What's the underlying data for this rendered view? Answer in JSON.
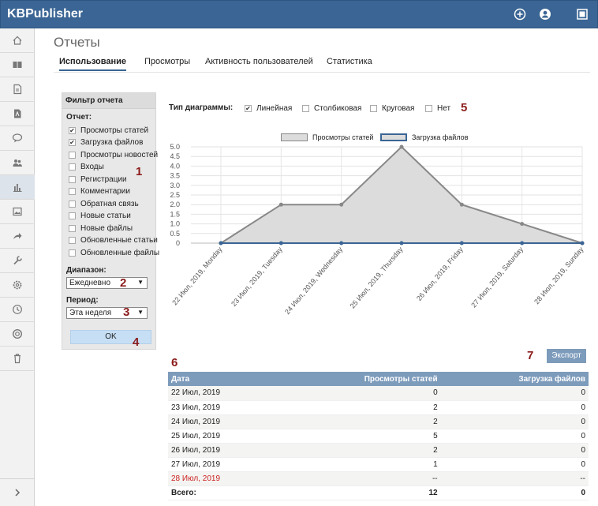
{
  "app": {
    "title": "KBPublisher"
  },
  "page": {
    "title": "Отчеты"
  },
  "tabs": [
    "Использование",
    "Просмотры",
    "Активность пользователей",
    "Статистика"
  ],
  "filter": {
    "title": "Фильтр отчета",
    "report_label": "Отчет:",
    "report_items": [
      {
        "label": "Просмотры статей",
        "checked": true
      },
      {
        "label": "Загрузка файлов",
        "checked": true
      },
      {
        "label": "Просмотры новостей",
        "checked": false
      },
      {
        "label": "Входы",
        "checked": false
      },
      {
        "label": "Регистрации",
        "checked": false
      },
      {
        "label": "Комментарии",
        "checked": false
      },
      {
        "label": "Обратная связь",
        "checked": false
      },
      {
        "label": "Новые статьи",
        "checked": false
      },
      {
        "label": "Новые файлы",
        "checked": false
      },
      {
        "label": "Обновленные статьи",
        "checked": false
      },
      {
        "label": "Обновленные файлы",
        "checked": false
      }
    ],
    "range_label": "Диапазон:",
    "range_value": "Ежедневно",
    "period_label": "Период:",
    "period_value": "Эта неделя",
    "ok_label": "OK"
  },
  "callouts": {
    "n1": "1",
    "n2": "2",
    "n3": "3",
    "n4": "4",
    "n5": "5",
    "n6": "6",
    "n7": "7"
  },
  "chart_type": {
    "label": "Тип диаграммы:",
    "options": [
      {
        "label": "Линейная",
        "checked": true
      },
      {
        "label": "Столбиковая",
        "checked": false
      },
      {
        "label": "Круговая",
        "checked": false
      },
      {
        "label": "Нет",
        "checked": false
      }
    ]
  },
  "export_label": "Экспорт",
  "chart_data": {
    "type": "area",
    "categories": [
      "22 Июл, 2019, Monday",
      "23 Июл, 2019, Tuesday",
      "24 Июл, 2019, Wednesday",
      "25 Июл, 2019, Thursday",
      "26 Июл, 2019, Friday",
      "27 Июл, 2019, Saturday",
      "28 Июл, 2019, Sunday"
    ],
    "series": [
      {
        "name": "Просмотры статей",
        "values": [
          0,
          2,
          2,
          5,
          2,
          1,
          0
        ],
        "color": "#888888",
        "fill": "#dcdcdc"
      },
      {
        "name": "Загрузка файлов",
        "values": [
          0,
          0,
          0,
          0,
          0,
          0,
          0
        ],
        "color": "#3a6594",
        "fill": "#dcdcdc"
      }
    ],
    "ylim": [
      0,
      5
    ],
    "yticks": [
      "0",
      "0.5",
      "1.0",
      "1.5",
      "2.0",
      "2.5",
      "3.0",
      "3.5",
      "4.0",
      "4.5",
      "5.0"
    ],
    "grid": true,
    "legend": "top-center"
  },
  "table": {
    "headers": [
      "Дата",
      "Просмотры статей",
      "Загрузка файлов"
    ],
    "rows": [
      {
        "date": "22 Июл, 2019",
        "views": "0",
        "files": "0"
      },
      {
        "date": "23 Июл, 2019",
        "views": "2",
        "files": "0"
      },
      {
        "date": "24 Июл, 2019",
        "views": "2",
        "files": "0"
      },
      {
        "date": "25 Июл, 2019",
        "views": "5",
        "files": "0"
      },
      {
        "date": "26 Июл, 2019",
        "views": "2",
        "files": "0"
      },
      {
        "date": "27 Июл, 2019",
        "views": "1",
        "files": "0"
      },
      {
        "date": "28 Июл, 2019",
        "views": "--",
        "files": "--",
        "weekend": true
      }
    ],
    "total": {
      "label": "Всего:",
      "views": "12",
      "files": "0"
    }
  },
  "icons": {
    "top": [
      "add-circle-icon",
      "user-circle-icon",
      "window-icon"
    ],
    "sidebar": [
      "home-icon",
      "book-icon",
      "document-icon",
      "pdf-file-icon",
      "chat-icon",
      "users-icon",
      "bar-chart-icon",
      "image-icon",
      "share-arrow-icon",
      "wrench-icon",
      "gear-icon",
      "clock-icon",
      "lifebuoy-icon",
      "trash-icon"
    ],
    "collapse": "chevron-right-icon"
  }
}
